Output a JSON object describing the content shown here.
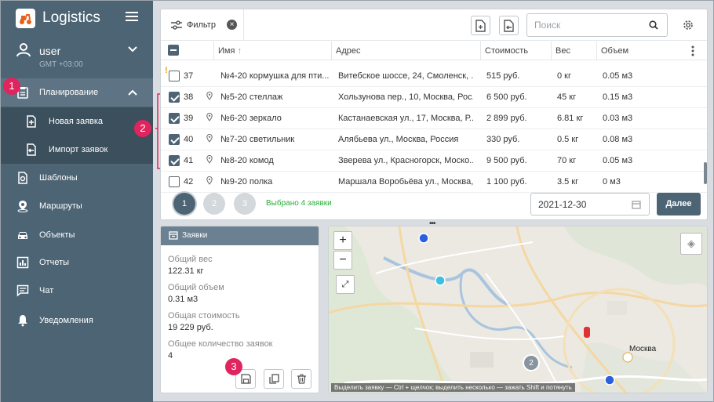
{
  "app": {
    "title": "Logistics"
  },
  "user": {
    "name": "user",
    "timezone": "GMT +03:00"
  },
  "sidebar": {
    "planning": "Планирование",
    "sub": [
      "Новая заявка",
      "Импорт заявок"
    ],
    "items": [
      "Шаблоны",
      "Маршруты",
      "Объекты",
      "Отчеты",
      "Чат",
      "Уведомления"
    ]
  },
  "callouts": [
    "1",
    "2",
    "3"
  ],
  "toolbar": {
    "filter_label": "Фильтр",
    "filter_close": "×",
    "search_placeholder": "Поиск"
  },
  "table": {
    "columns": [
      "Имя",
      "Адрес",
      "Стоимость",
      "Вес",
      "Объем"
    ],
    "rows": [
      {
        "num": "37",
        "name": "№4-20 кормушка для пти...",
        "addr": "Витебское шоссе, 24, Смоленск, ...",
        "cost": "515 руб.",
        "weight": "0 кг",
        "volume": "0.05 м3",
        "checked": false,
        "warning": true
      },
      {
        "num": "38",
        "name": "№5-20 стеллаж",
        "addr": "Хользунова пер., 10, Москва, Рос...",
        "cost": "6 500 руб.",
        "weight": "45 кг",
        "volume": "0.15 м3",
        "checked": true,
        "warning": false
      },
      {
        "num": "39",
        "name": "№6-20 зеркало",
        "addr": "Кастанаевская ул., 17, Москва, Р...",
        "cost": "2 899 руб.",
        "weight": "6.81 кг",
        "volume": "0.03 м3",
        "checked": true,
        "warning": false
      },
      {
        "num": "40",
        "name": "№7-20 светильник",
        "addr": "Алябьева ул., Москва, Россия",
        "cost": "330 руб.",
        "weight": "0.5 кг",
        "volume": "0.08 м3",
        "checked": true,
        "warning": false
      },
      {
        "num": "41",
        "name": "№8-20 комод",
        "addr": "Зверева ул., Красногорск, Моско...",
        "cost": "9 500 руб.",
        "weight": "70 кг",
        "volume": "0.05 м3",
        "checked": true,
        "warning": false
      },
      {
        "num": "42",
        "name": "№9-20 полка",
        "addr": "Маршала Воробьёва ул., Москва,...",
        "cost": "1 100 руб.",
        "weight": "3.5 кг",
        "volume": "0 м3",
        "checked": false,
        "warning": false
      }
    ]
  },
  "pagination": {
    "pages": [
      "1",
      "2",
      "3"
    ],
    "current": "1",
    "selected_info": "Выбрано 4 заявки"
  },
  "date": {
    "value": "2021-12-30"
  },
  "next_label": "Далее",
  "summary": {
    "title": "Заявки",
    "fields": [
      {
        "label": "Общий вес",
        "value": "122.31 кг"
      },
      {
        "label": "Общий объем",
        "value": "0.31 м3"
      },
      {
        "label": "Общая стоимость",
        "value": "19 229 руб."
      },
      {
        "label": "Общее количество заявок",
        "value": "4"
      }
    ]
  },
  "map": {
    "zoom_in": "+",
    "zoom_out": "−",
    "city_label": "Москва",
    "cluster_count": "2",
    "hint": "Выделить заявку — Ctrl + щелчок; выделить несколько — зажать Shift и потянуть"
  },
  "colors": {
    "sidebar": "#4c6474",
    "accent_badge": "#e0245e",
    "selected_text": "#27ae3c"
  }
}
